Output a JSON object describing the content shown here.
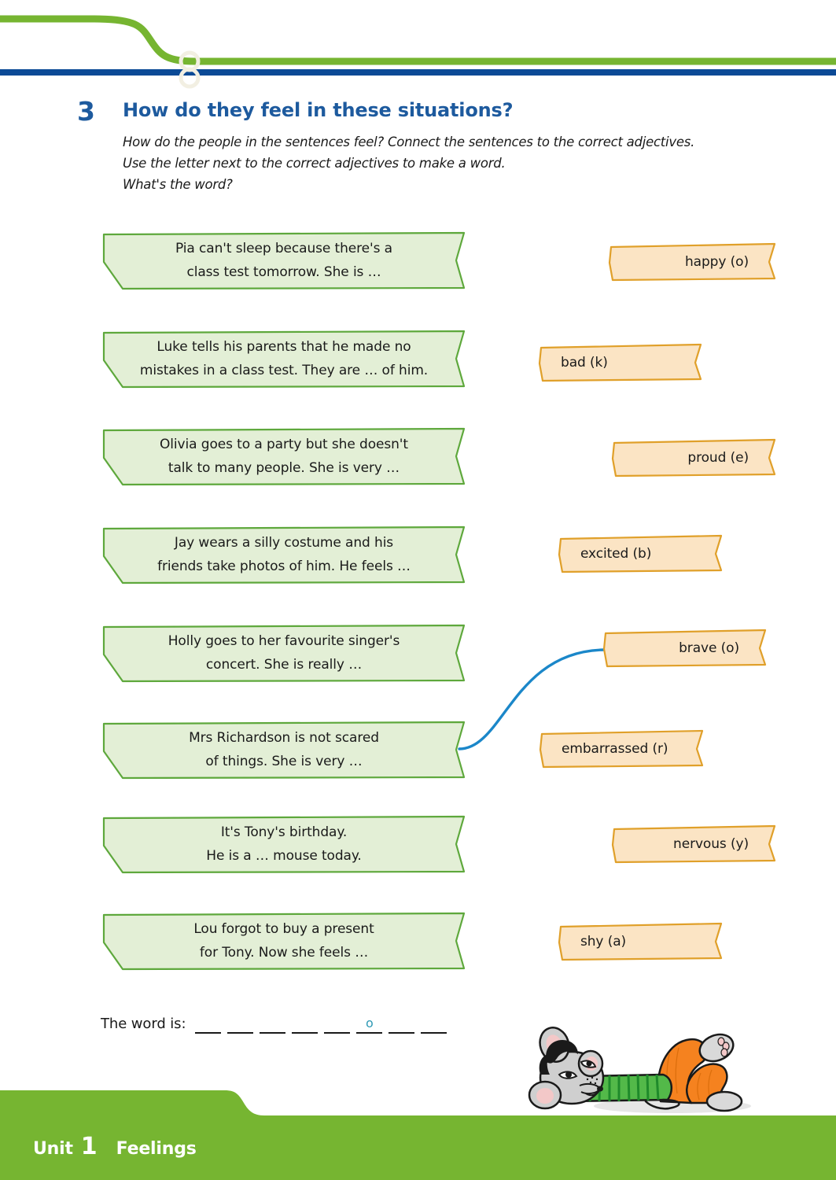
{
  "colors": {
    "brand_blue": "#1d5a9e",
    "rule_blue": "#0b4a96",
    "brand_green": "#76b531",
    "banner_fill": "#e3efd6",
    "banner_stroke": "#5ea83c",
    "card_fill": "#fbe4c4",
    "card_stroke": "#e0a02a",
    "connector_blue": "#1b87c9",
    "answer_letter": "#2f9ab5",
    "footer_green": "#76b531",
    "knot_cream": "#f2efe2"
  },
  "header": {
    "decoration": "green-curve-and-blue-rule",
    "knot_icon": "figure-eight-knot-icon"
  },
  "task": {
    "number": "3",
    "title": "How do they feel in these situations?",
    "instructions": [
      "How do the people in the sentences feel? Connect the sentences to the correct adjectives.",
      "Use the letter next to the correct adjectives to make a word.",
      "What's the word?"
    ]
  },
  "sentences": [
    {
      "line1": "Pia can't sleep because there's a",
      "line2": "class test tomorrow. She is …"
    },
    {
      "line1": "Luke tells his parents that he made no",
      "line2": "mistakes in a class test. They are … of him."
    },
    {
      "line1": "Olivia goes to a party but she doesn't",
      "line2": "talk to many people. She is very …"
    },
    {
      "line1": "Jay wears a silly costume and his",
      "line2": "friends take photos of him. He feels …"
    },
    {
      "line1": "Holly goes to her favourite singer's",
      "line2": "concert. She is really …"
    },
    {
      "line1": "Mrs Richardson is not scared",
      "line2": "of things. She is very …"
    },
    {
      "line1": "It's Tony's birthday.",
      "line2": "He is a … mouse today."
    },
    {
      "line1": "Lou forgot to buy a present",
      "line2": "for Tony. Now she feels …"
    }
  ],
  "adjectives": [
    {
      "label": "happy (o)"
    },
    {
      "label": "bad (k)"
    },
    {
      "label": "proud (e)"
    },
    {
      "label": "excited (b)"
    },
    {
      "label": "brave (o)"
    },
    {
      "label": "embarrassed (r)"
    },
    {
      "label": "nervous (y)"
    },
    {
      "label": "shy (a)"
    }
  ],
  "connection": {
    "from": "Mrs Richardson is not scared of things. She is very …",
    "to": "brave (o)"
  },
  "answer": {
    "label": "The word is:",
    "blank_count": 8,
    "letters": [
      "",
      "",
      "",
      "",
      "",
      "o",
      "",
      ""
    ]
  },
  "footer": {
    "unit_label": "Unit",
    "unit_number": "1",
    "topic": "Feelings",
    "mascot": "mouse-lying-down-icon"
  }
}
